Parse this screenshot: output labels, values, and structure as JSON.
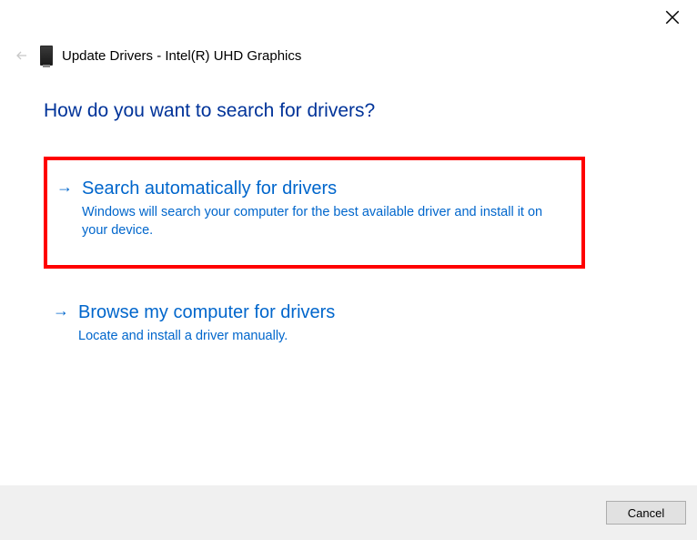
{
  "window": {
    "title": "Update Drivers - Intel(R) UHD Graphics"
  },
  "heading": "How do you want to search for drivers?",
  "options": [
    {
      "title": "Search automatically for drivers",
      "description": "Windows will search your computer for the best available driver and install it on your device."
    },
    {
      "title": "Browse my computer for drivers",
      "description": "Locate and install a driver manually."
    }
  ],
  "buttons": {
    "cancel": "Cancel"
  }
}
